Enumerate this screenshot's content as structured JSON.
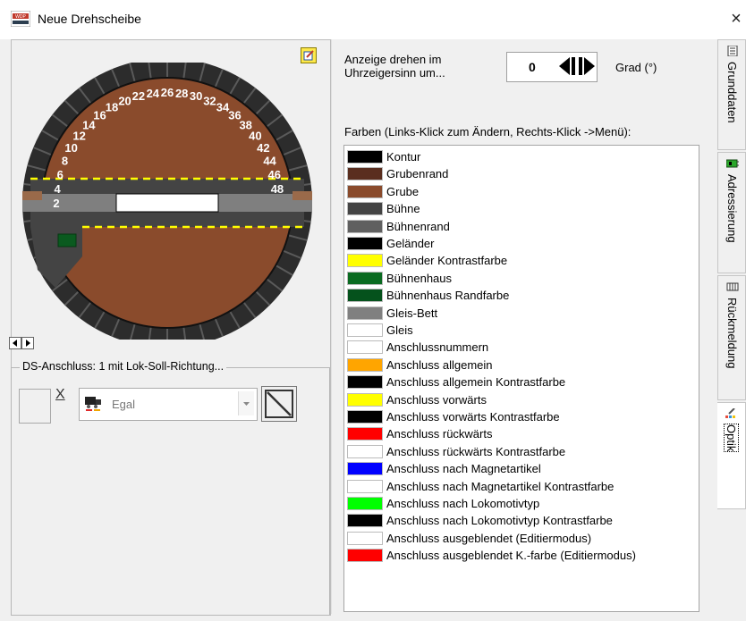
{
  "window": {
    "title": "Neue Drehscheibe",
    "close_label": "×",
    "app_icon": "wdp-app-icon"
  },
  "turntable": {
    "track_numbers": [
      "2",
      "4",
      "6",
      "8",
      "10",
      "12",
      "14",
      "16",
      "18",
      "20",
      "22",
      "24",
      "26",
      "28",
      "30",
      "32",
      "34",
      "36",
      "38",
      "40",
      "42",
      "44",
      "46",
      "48"
    ],
    "colors": {
      "ring": "#2c2c2c",
      "pit": "#8a4b2c",
      "bridge": "#444444",
      "bed": "#7f7f7f",
      "rail": "#ffffff",
      "railing_contrast": "#ffff00",
      "house": "#0a5a1f"
    }
  },
  "ds_connection": {
    "legend": "DS-Anschluss: 1 mit Lok-Soll-Richtung...",
    "x_label": "X",
    "dropdown_value": "Egal"
  },
  "rotation": {
    "label": "Anzeige drehen im Uhrzeigersinn um...",
    "value": "0",
    "unit": "Grad (°)"
  },
  "colors_heading": "Farben (Links-Klick zum Ändern, Rechts-Klick ->Menü):",
  "color_items": [
    {
      "label": "Kontur",
      "color": "#000000"
    },
    {
      "label": "Grubenrand",
      "color": "#5a2e1f"
    },
    {
      "label": "Grube",
      "color": "#8a4b2c"
    },
    {
      "label": "Bühne",
      "color": "#444444"
    },
    {
      "label": "Bühnenrand",
      "color": "#606060"
    },
    {
      "label": "Geländer",
      "color": "#000000"
    },
    {
      "label": "Geländer Kontrastfarbe",
      "color": "#ffff00"
    },
    {
      "label": "Bühnenhaus",
      "color": "#0a6b21"
    },
    {
      "label": "Bühnenhaus Randfarbe",
      "color": "#05521c"
    },
    {
      "label": "Gleis-Bett",
      "color": "#808080"
    },
    {
      "label": "Gleis",
      "color": "#ffffff"
    },
    {
      "label": "Anschlussnummern",
      "color": "#ffffff"
    },
    {
      "label": "Anschluss allgemein",
      "color": "#ffa500"
    },
    {
      "label": "Anschluss allgemein Kontrastfarbe",
      "color": "#000000"
    },
    {
      "label": "Anschluss vorwärts",
      "color": "#ffff00"
    },
    {
      "label": "Anschluss vorwärts Kontrastfarbe",
      "color": "#000000"
    },
    {
      "label": "Anschluss rückwärts",
      "color": "#ff0000"
    },
    {
      "label": "Anschluss rückwärts Kontrastfarbe",
      "color": "#ffffff"
    },
    {
      "label": "Anschluss nach Magnetartikel",
      "color": "#0000ff"
    },
    {
      "label": "Anschluss nach Magnetartikel Kontrastfarbe",
      "color": "#ffffff"
    },
    {
      "label": "Anschluss nach Lokomotivtyp",
      "color": "#00ff00"
    },
    {
      "label": "Anschluss nach Lokomotivtyp Kontrastfarbe",
      "color": "#000000"
    },
    {
      "label": "Anschluss ausgeblendet (Editiermodus)",
      "color": "#ffffff"
    },
    {
      "label": "Anschluss ausgeblendet K.-farbe (Editiermodus)",
      "color": "#ff0000"
    }
  ],
  "tabs": [
    {
      "label": "Grunddaten",
      "icon": "document-icon"
    },
    {
      "label": "Adressierung",
      "icon": "decoder-icon"
    },
    {
      "label": "Rückmeldung",
      "icon": "track-sensor-icon"
    },
    {
      "label": "Optik",
      "icon": "paint-icon"
    }
  ]
}
